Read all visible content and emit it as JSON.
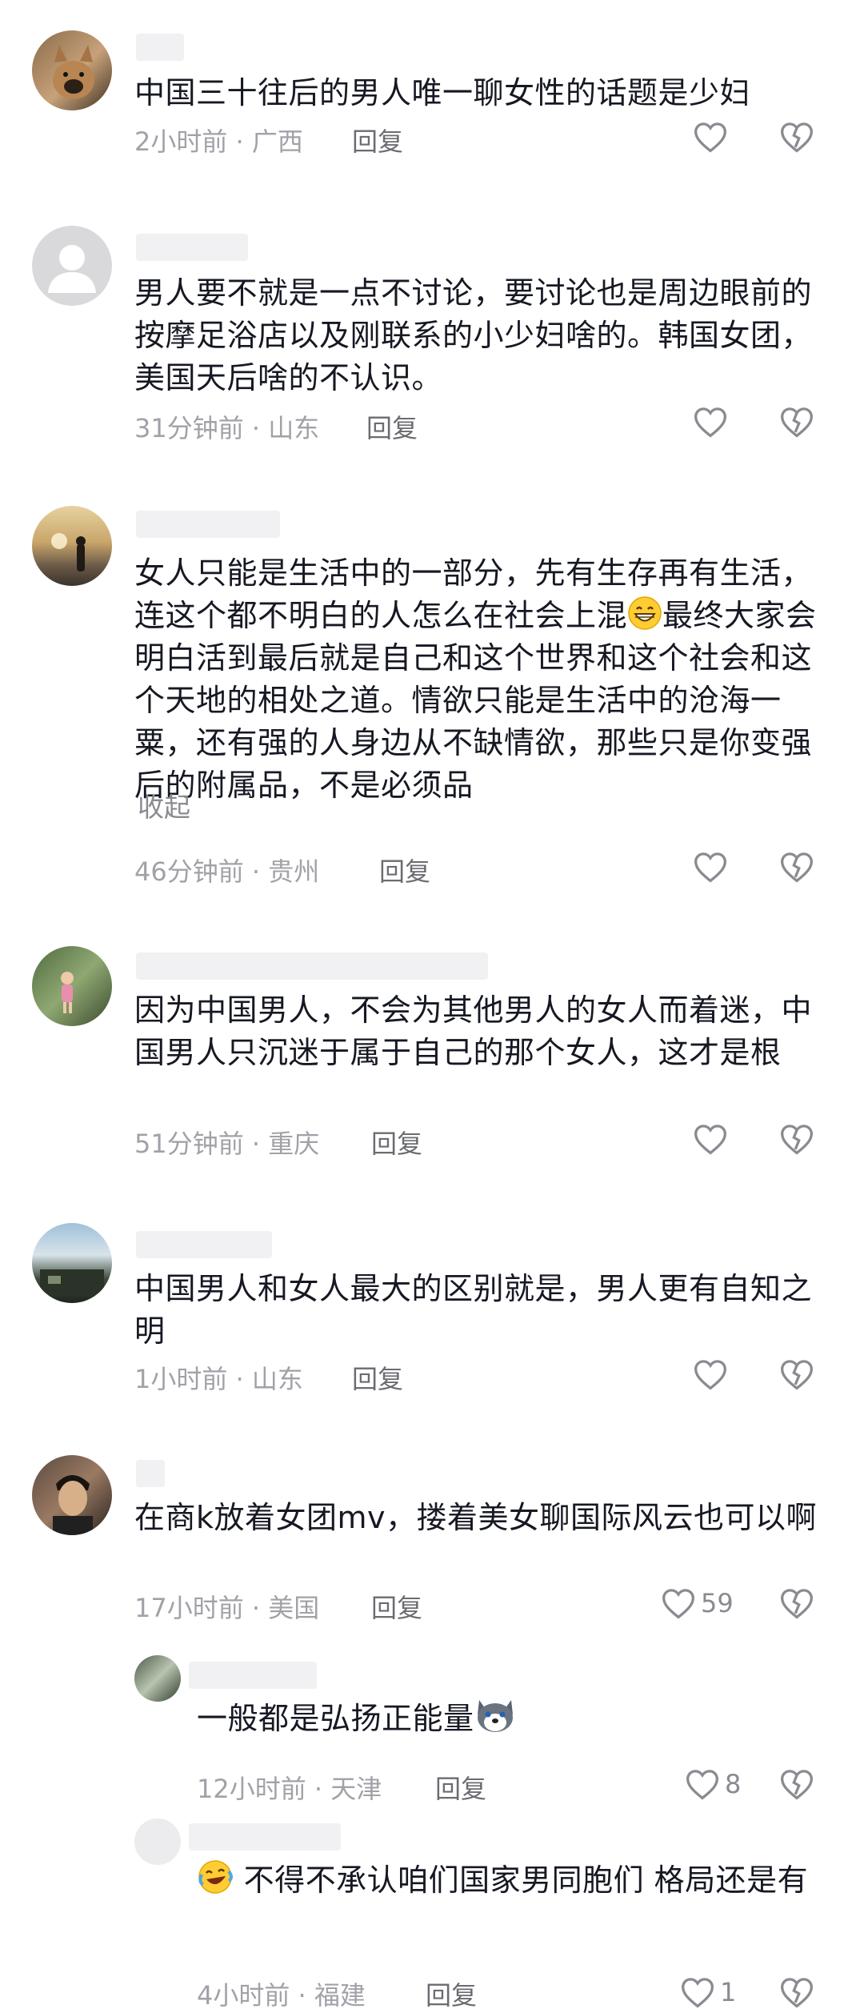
{
  "comments": [
    {
      "text": "中国三十往后的男人唯一聊女性的话题是少妇",
      "time": "2小时前",
      "location": "广西",
      "reply": "回复"
    },
    {
      "text": "男人要不就是一点不讨论，要讨论也是周边眼前的按摩足浴店以及刚联系的小少妇啥的。韩国女团，美国天后啥的不认识。",
      "time": "31分钟前",
      "location": "山东",
      "reply": "回复"
    },
    {
      "text_a": "女人只能是生活中的一部分，先有生存再有生活，连这个都不明白的人怎么在社会上混",
      "text_b": "最终大家会明白活到最后就是自己和这个世界和这个社会和这个天地的相处之道。情欲只能是生活中的沧海一粟，还有强的人身边从不缺情欲，那些只是你变强后的附属品，不是必须品",
      "collapse": "收起",
      "time": "46分钟前",
      "location": "贵州",
      "reply": "回复"
    },
    {
      "text": "因为中国男人，不会为其他男人的女人而着迷，中国男人只沉迷于属于自己的那个女人，这才是根",
      "time": "51分钟前",
      "location": "重庆",
      "reply": "回复"
    },
    {
      "text": "中国男人和女人最大的区别就是，男人更有自知之明",
      "time": "1小时前",
      "location": "山东",
      "reply": "回复"
    },
    {
      "text": "在商k放着女团mv，搂着美女聊国际风云也可以啊",
      "time": "17小时前",
      "location": "美国",
      "reply": "回复",
      "likes": "59"
    }
  ],
  "replies": [
    {
      "text": "一般都是弘扬正能量",
      "time": "12小时前",
      "location": "天津",
      "reply": "回复",
      "likes": "8"
    },
    {
      "text": "不得不承认咱们国家男同胞们 格局还是有",
      "time": "4小时前",
      "location": "福建",
      "reply": "回复",
      "likes": "1"
    }
  ],
  "separator": "·",
  "colors": {
    "text": "#161823",
    "meta": "#a1a2a8",
    "icon": "#8a8b91"
  }
}
